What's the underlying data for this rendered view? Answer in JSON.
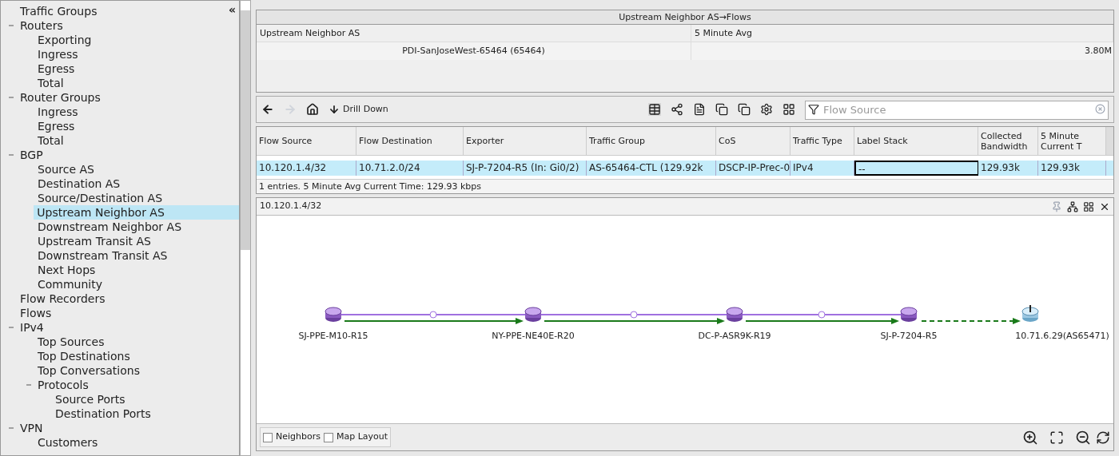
{
  "sidebar": {
    "collapse_label": "«",
    "tree": [
      {
        "label": "Traffic Groups",
        "selected": false
      },
      {
        "label": "Routers",
        "selected": false,
        "expanded": true,
        "children": [
          {
            "label": "Exporting",
            "selected": false
          },
          {
            "label": "Ingress",
            "selected": false
          },
          {
            "label": "Egress",
            "selected": false
          },
          {
            "label": "Total",
            "selected": false
          }
        ]
      },
      {
        "label": "Router Groups",
        "selected": false,
        "expanded": true,
        "children": [
          {
            "label": "Ingress",
            "selected": false
          },
          {
            "label": "Egress",
            "selected": false
          },
          {
            "label": "Total",
            "selected": false
          }
        ]
      },
      {
        "label": "BGP",
        "selected": false,
        "expanded": true,
        "children": [
          {
            "label": "Source AS",
            "selected": false
          },
          {
            "label": "Destination AS",
            "selected": false
          },
          {
            "label": "Source/Destination AS",
            "selected": false
          },
          {
            "label": "Upstream Neighbor AS",
            "selected": true
          },
          {
            "label": "Downstream Neighbor AS",
            "selected": false
          },
          {
            "label": "Upstream Transit AS",
            "selected": false
          },
          {
            "label": "Downstream Transit AS",
            "selected": false
          },
          {
            "label": "Next Hops",
            "selected": false
          },
          {
            "label": "Community",
            "selected": false
          }
        ]
      },
      {
        "label": "Flow Recorders",
        "selected": false
      },
      {
        "label": "Flows",
        "selected": false
      },
      {
        "label": "IPv4",
        "selected": false,
        "expanded": true,
        "children": [
          {
            "label": "Top Sources",
            "selected": false
          },
          {
            "label": "Top Destinations",
            "selected": false
          },
          {
            "label": "Top Conversations",
            "selected": false
          },
          {
            "label": "Protocols",
            "selected": false,
            "expanded": true,
            "children": [
              {
                "label": "Source Ports",
                "selected": false
              },
              {
                "label": "Destination Ports",
                "selected": false
              }
            ]
          }
        ]
      },
      {
        "label": "VPN",
        "selected": false,
        "expanded": true,
        "children": [
          {
            "label": "Customers",
            "selected": false
          }
        ]
      }
    ]
  },
  "summary": {
    "title": "Upstream Neighbor AS→Flows",
    "columns": [
      "Upstream Neighbor AS",
      "5 Minute Avg"
    ],
    "row": [
      "PDI-SanJoseWest-65464 (65464)",
      "3.80M"
    ]
  },
  "toolbar": {
    "drill_down": "Drill Down",
    "search": {
      "placeholder": "Flow Source"
    }
  },
  "flows": {
    "columns": [
      "Flow Source",
      "Flow Destination",
      "Exporter",
      "Traffic Group",
      "CoS",
      "Traffic Type",
      "Label Stack",
      "Collected Bandwidth",
      "5 Minute Current T"
    ],
    "rows": [
      {
        "selected": true,
        "cells": [
          "10.120.1.4/32",
          "10.71.2.0/24",
          "SJ-P-7204-R5 (In: Gi0/2)",
          "AS-65464-CTL (129.92k",
          "DSCP-IP-Prec-0",
          "IPv4",
          "--",
          "129.93k",
          "129.93k"
        ]
      }
    ],
    "status": "1 entries.  5 Minute Avg Current Time: 129.93 kbps"
  },
  "map": {
    "title": "10.120.1.4/32",
    "nodes": [
      {
        "label": "SJ-PPE-M10-R15",
        "kind": "router"
      },
      {
        "label": "NY-PPE-NE40E-R20",
        "kind": "router"
      },
      {
        "label": "DC-P-ASR9K-R19",
        "kind": "router"
      },
      {
        "label": "SJ-P-7204-R5",
        "kind": "router"
      },
      {
        "label": "10.71.6.29(AS65471)",
        "kind": "host"
      }
    ],
    "links": [
      {
        "kind": "solid"
      },
      {
        "kind": "solid"
      },
      {
        "kind": "solid"
      },
      {
        "kind": "dashed"
      }
    ],
    "options": [
      {
        "label": "Neighbors",
        "checked": false
      },
      {
        "label": "Map Layout",
        "checked": false
      }
    ]
  }
}
